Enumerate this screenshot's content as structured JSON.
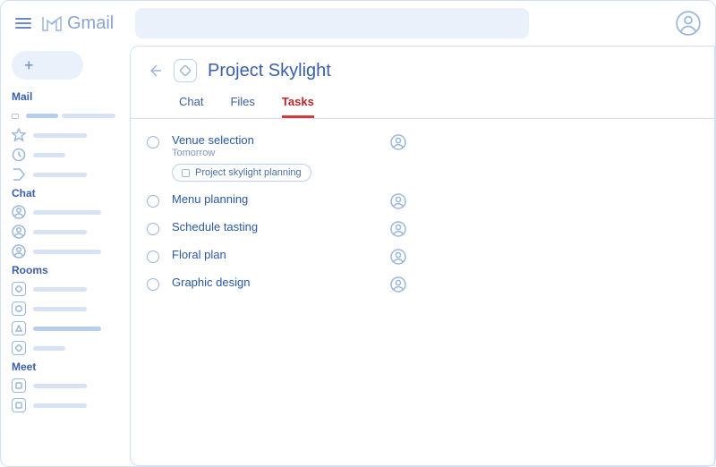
{
  "header": {
    "product_name": "Gmail"
  },
  "sidebar": {
    "sections": {
      "mail": "Mail",
      "chat": "Chat",
      "rooms": "Rooms",
      "meet": "Meet"
    }
  },
  "room": {
    "title": "Project Skylight",
    "tabs": {
      "chat": "Chat",
      "files": "Files",
      "tasks": "Tasks"
    },
    "active_tab": "tasks"
  },
  "tasks": [
    {
      "title": "Venue selection",
      "subtitle": "Tomorrow",
      "chip": "Project skylight planning"
    },
    {
      "title": "Menu planning"
    },
    {
      "title": "Schedule tasting"
    },
    {
      "title": "Floral plan"
    },
    {
      "title": "Graphic design"
    }
  ]
}
